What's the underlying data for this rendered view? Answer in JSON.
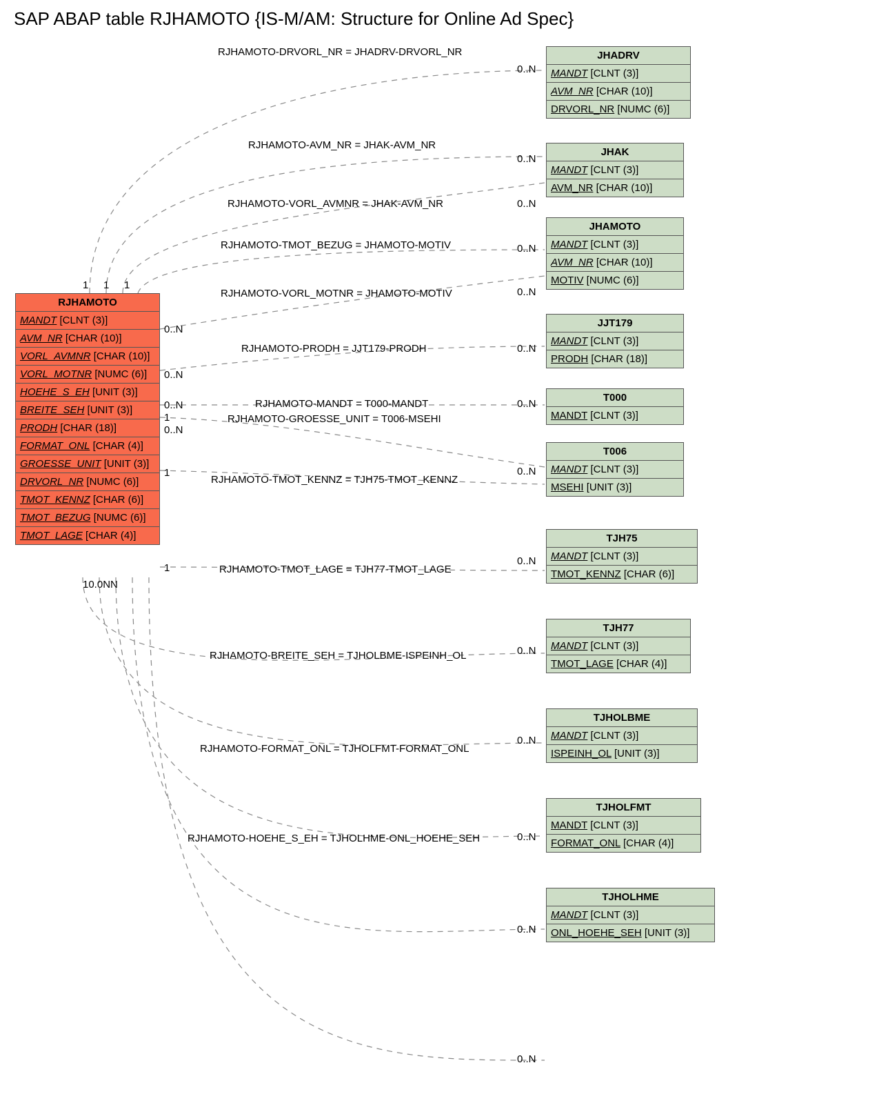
{
  "title": "SAP ABAP table RJHAMOTO {IS-M/AM: Structure for Online Ad Spec}",
  "main": {
    "name": "RJHAMOTO",
    "fields": [
      {
        "n": "MANDT",
        "t": "[CLNT (3)]"
      },
      {
        "n": "AVM_NR",
        "t": "[CHAR (10)]"
      },
      {
        "n": "VORL_AVMNR",
        "t": "[CHAR (10)]"
      },
      {
        "n": "VORL_MOTNR",
        "t": "[NUMC (6)]"
      },
      {
        "n": "HOEHE_S_EH",
        "t": "[UNIT (3)]"
      },
      {
        "n": "BREITE_SEH",
        "t": "[UNIT (3)]"
      },
      {
        "n": "PRODH",
        "t": "[CHAR (18)]"
      },
      {
        "n": "FORMAT_ONL",
        "t": "[CHAR (4)]"
      },
      {
        "n": "GROESSE_UNIT",
        "t": "[UNIT (3)]"
      },
      {
        "n": "DRVORL_NR",
        "t": "[NUMC (6)]"
      },
      {
        "n": "TMOT_KENNZ",
        "t": "[CHAR (6)]"
      },
      {
        "n": "TMOT_BEZUG",
        "t": "[NUMC (6)]"
      },
      {
        "n": "TMOT_LAGE",
        "t": "[CHAR (4)]"
      }
    ]
  },
  "refs": [
    {
      "name": "JHADRV",
      "fields": [
        {
          "n": "MANDT",
          "t": "[CLNT (3)]",
          "u": 1
        },
        {
          "n": "AVM_NR",
          "t": "[CHAR (10)]",
          "u": 1
        },
        {
          "n": "DRVORL_NR",
          "t": "[NUMC (6)]",
          "u": 2
        }
      ]
    },
    {
      "name": "JHAK",
      "fields": [
        {
          "n": "MANDT",
          "t": "[CLNT (3)]",
          "u": 1
        },
        {
          "n": "AVM_NR",
          "t": "[CHAR (10)]",
          "u": 2
        }
      ]
    },
    {
      "name": "JHAMOTO",
      "fields": [
        {
          "n": "MANDT",
          "t": "[CLNT (3)]",
          "u": 1
        },
        {
          "n": "AVM_NR",
          "t": "[CHAR (10)]",
          "u": 1
        },
        {
          "n": "MOTIV",
          "t": "[NUMC (6)]",
          "u": 2
        }
      ]
    },
    {
      "name": "JJT179",
      "fields": [
        {
          "n": "MANDT",
          "t": "[CLNT (3)]",
          "u": 1
        },
        {
          "n": "PRODH",
          "t": "[CHAR (18)]",
          "u": 2
        }
      ]
    },
    {
      "name": "T000",
      "fields": [
        {
          "n": "MANDT",
          "t": "[CLNT (3)]",
          "u": 2
        }
      ]
    },
    {
      "name": "T006",
      "fields": [
        {
          "n": "MANDT",
          "t": "[CLNT (3)]",
          "u": 1
        },
        {
          "n": "MSEHI",
          "t": "[UNIT (3)]",
          "u": 2
        }
      ]
    },
    {
      "name": "TJH75",
      "fields": [
        {
          "n": "MANDT",
          "t": "[CLNT (3)]",
          "u": 1
        },
        {
          "n": "TMOT_KENNZ",
          "t": "[CHAR (6)]",
          "u": 2
        }
      ]
    },
    {
      "name": "TJH77",
      "fields": [
        {
          "n": "MANDT",
          "t": "[CLNT (3)]",
          "u": 1
        },
        {
          "n": "TMOT_LAGE",
          "t": "[CHAR (4)]",
          "u": 2
        }
      ]
    },
    {
      "name": "TJHOLBME",
      "fields": [
        {
          "n": "MANDT",
          "t": "[CLNT (3)]",
          "u": 1
        },
        {
          "n": "ISPEINH_OL",
          "t": "[UNIT (3)]",
          "u": 2
        }
      ]
    },
    {
      "name": "TJHOLFMT",
      "fields": [
        {
          "n": "MANDT",
          "t": "[CLNT (3)]",
          "u": 2
        },
        {
          "n": "FORMAT_ONL",
          "t": "[CHAR (4)]",
          "u": 2
        }
      ]
    },
    {
      "name": "TJHOLHME",
      "fields": [
        {
          "n": "MANDT",
          "t": "[CLNT (3)]",
          "u": 1
        },
        {
          "n": "ONL_HOEHE_SEH",
          "t": "[UNIT (3)]",
          "u": 2
        }
      ]
    }
  ],
  "rels": [
    {
      "txt": "RJHAMOTO-DRVORL_NR = JHADRV-DRVORL_NR"
    },
    {
      "txt": "RJHAMOTO-AVM_NR = JHAK-AVM_NR"
    },
    {
      "txt": "RJHAMOTO-VORL_AVMNR = JHAK-AVM_NR"
    },
    {
      "txt": "RJHAMOTO-TMOT_BEZUG = JHAMOTO-MOTIV"
    },
    {
      "txt": "RJHAMOTO-VORL_MOTNR = JHAMOTO-MOTIV"
    },
    {
      "txt": "RJHAMOTO-PRODH = JJT179-PRODH"
    },
    {
      "txt": "RJHAMOTO-MANDT = T000-MANDT"
    },
    {
      "txt": "RJHAMOTO-GROESSE_UNIT = T006-MSEHI"
    },
    {
      "txt": "RJHAMOTO-TMOT_KENNZ = TJH75-TMOT_KENNZ"
    },
    {
      "txt": "RJHAMOTO-TMOT_LAGE = TJH77-TMOT_LAGE"
    },
    {
      "txt": "RJHAMOTO-BREITE_SEH = TJHOLBME-ISPEINH_OL"
    },
    {
      "txt": "RJHAMOTO-FORMAT_ONL = TJHOLFMT-FORMAT_ONL"
    },
    {
      "txt": "RJHAMOTO-HOEHE_S_EH = TJHOLHME-ONL_HOEHE_SEH"
    }
  ],
  "card": {
    "one": "1",
    "many": "0..N",
    "bottom": "10.0NN"
  }
}
